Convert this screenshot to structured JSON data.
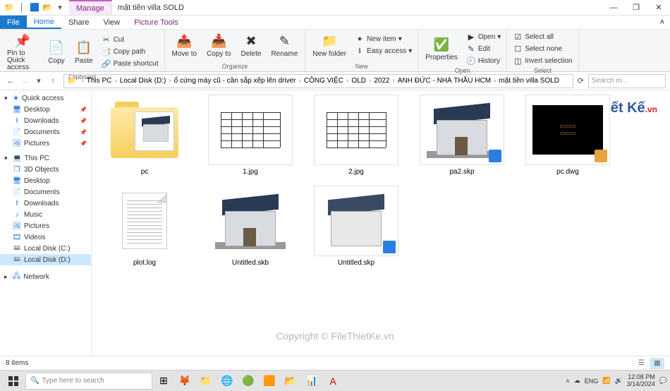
{
  "titlebar": {
    "contextual_tab": "Manage",
    "window_title": "mặt tiền villa SOLD"
  },
  "ribbon_tabs": {
    "file": "File",
    "home": "Home",
    "share": "Share",
    "view": "View",
    "picture_tools": "Picture Tools"
  },
  "ribbon": {
    "clipboard": {
      "pin": "Pin to Quick access",
      "copy": "Copy",
      "paste": "Paste",
      "cut": "Cut",
      "copy_path": "Copy path",
      "paste_shortcut": "Paste shortcut",
      "label": "Clipboard"
    },
    "organize": {
      "move_to": "Move to",
      "copy_to": "Copy to",
      "delete": "Delete",
      "rename": "Rename",
      "label": "Organize"
    },
    "new": {
      "new_folder": "New folder",
      "new_item": "New item",
      "easy_access": "Easy access",
      "label": "New"
    },
    "open": {
      "properties": "Properties",
      "open": "Open",
      "edit": "Edit",
      "history": "History",
      "label": "Open"
    },
    "select": {
      "select_all": "Select all",
      "select_none": "Select none",
      "invert": "Invert selection",
      "label": "Select"
    }
  },
  "breadcrumb": {
    "items": [
      "This PC",
      "Local Disk (D:)",
      "ổ cứng máy cũ - cần sắp xếp lên driver",
      "CÔNG VIỆC",
      "OLD",
      "2022",
      "ANH ĐỨC - NHÀ THẦU HCM",
      "mặt tiền villa SOLD"
    ]
  },
  "search": {
    "placeholder": "Search m..."
  },
  "sidebar": {
    "quick_access": {
      "label": "Quick access",
      "items": [
        "Desktop",
        "Downloads",
        "Documents",
        "Pictures"
      ]
    },
    "this_pc": {
      "label": "This PC",
      "items": [
        "3D Objects",
        "Desktop",
        "Documents",
        "Downloads",
        "Music",
        "Pictures",
        "Videos",
        "Local Disk (C:)",
        "Local Disk (D:)"
      ]
    },
    "network": {
      "label": "Network"
    }
  },
  "files": [
    {
      "name": "pc",
      "type": "folder"
    },
    {
      "name": "1.jpg",
      "type": "image-plan"
    },
    {
      "name": "2.jpg",
      "type": "image-plan"
    },
    {
      "name": "pa2.skp",
      "type": "skp"
    },
    {
      "name": "pc.dwg",
      "type": "dwg"
    },
    {
      "name": "plot.log",
      "type": "text"
    },
    {
      "name": "Untitled.skb",
      "type": "skp"
    },
    {
      "name": "Untitled.skp",
      "type": "skp"
    }
  ],
  "statusbar": {
    "count": "8 items"
  },
  "taskbar": {
    "search_placeholder": "Type here to search",
    "time": "12:08 PM",
    "date": "3/14/2024"
  },
  "watermark": {
    "center": "Copyright © FileThietKe.vn"
  }
}
